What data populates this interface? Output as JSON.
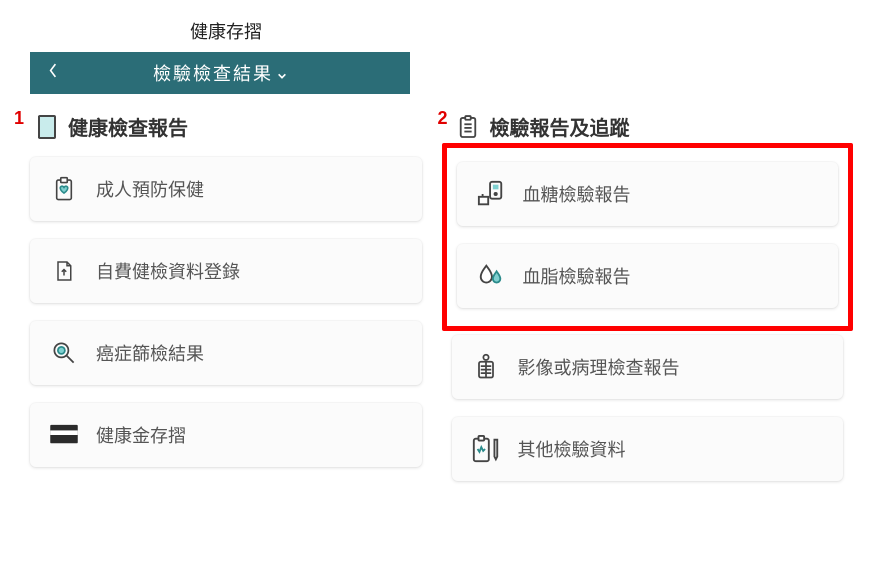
{
  "app_title": "健康存摺",
  "nav": {
    "title": "檢驗檢查結果"
  },
  "annotations": {
    "a1": "1",
    "a2": "2"
  },
  "left": {
    "header": "健康檢查報告",
    "items": [
      {
        "label": "成人預防保健"
      },
      {
        "label": "自費健檢資料登錄"
      },
      {
        "label": "癌症篩檢結果"
      },
      {
        "label": "健康金存摺"
      }
    ]
  },
  "right": {
    "header": "檢驗報告及追蹤",
    "items": [
      {
        "label": "血糖檢驗報告"
      },
      {
        "label": "血脂檢驗報告"
      },
      {
        "label": "影像或病理檢查報告"
      },
      {
        "label": "其他檢驗資料"
      }
    ]
  }
}
